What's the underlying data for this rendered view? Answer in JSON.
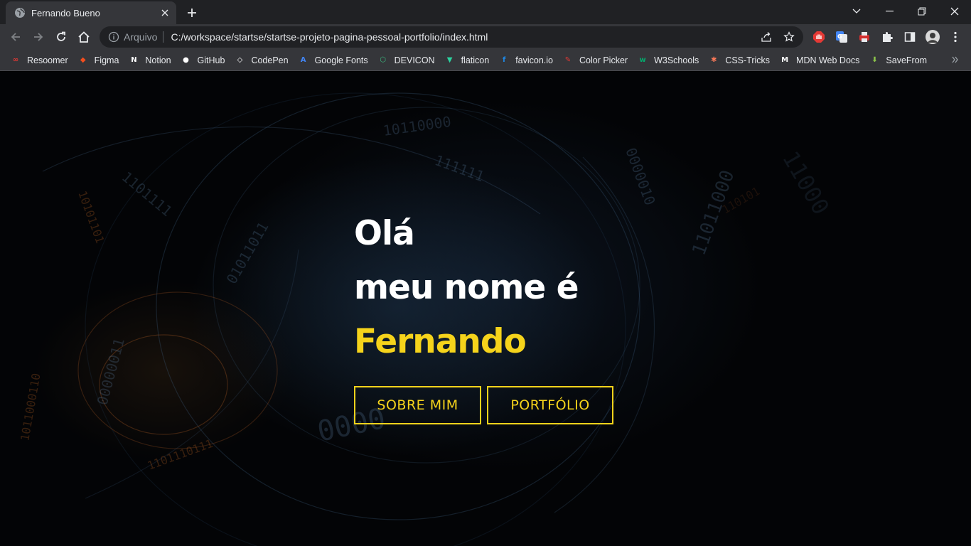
{
  "browser": {
    "tab": {
      "title": "Fernando Bueno"
    },
    "omnibox": {
      "scheme_label": "Arquivo",
      "url": "C:/workspace/startse/startse-projeto-pagina-pessoal-portfolio/index.html"
    },
    "bookmarks": [
      {
        "label": "Resoomer",
        "icon": "resoomer-icon",
        "color": "#e53935"
      },
      {
        "label": "Figma",
        "icon": "figma-icon",
        "color": "#f24e1e"
      },
      {
        "label": "Notion",
        "icon": "notion-icon",
        "color": "#ffffff"
      },
      {
        "label": "GitHub",
        "icon": "github-icon",
        "color": "#ffffff"
      },
      {
        "label": "CodePen",
        "icon": "codepen-icon",
        "color": "#ffffff"
      },
      {
        "label": "Google Fonts",
        "icon": "google-fonts-icon",
        "color": "#4285f4"
      },
      {
        "label": "DEVICON",
        "icon": "devicon-icon",
        "color": "#3ab77e"
      },
      {
        "label": "flaticon",
        "icon": "flaticon-icon",
        "color": "#2bd4a0"
      },
      {
        "label": "favicon.io",
        "icon": "favicon-io-icon",
        "color": "#1e88e5"
      },
      {
        "label": "Color Picker",
        "icon": "color-picker-icon",
        "color": "#e53935"
      },
      {
        "label": "W3Schools",
        "icon": "w3schools-icon",
        "color": "#04aa6d"
      },
      {
        "label": "CSS-Tricks",
        "icon": "css-tricks-icon",
        "color": "#ff7a59"
      },
      {
        "label": "MDN Web Docs",
        "icon": "mdn-icon",
        "color": "#ffffff"
      },
      {
        "label": "SaveFrom",
        "icon": "savefrom-icon",
        "color": "#8bc34a"
      }
    ]
  },
  "hero": {
    "line1": "Olá",
    "line2": "meu nome é",
    "name": "Fernando",
    "buttons": {
      "about": "SOBRE MIM",
      "portfolio": "PORTFÓLIO"
    }
  },
  "colors": {
    "accent": "#f5d31b",
    "text": "#ffffff",
    "background": "#030406"
  }
}
